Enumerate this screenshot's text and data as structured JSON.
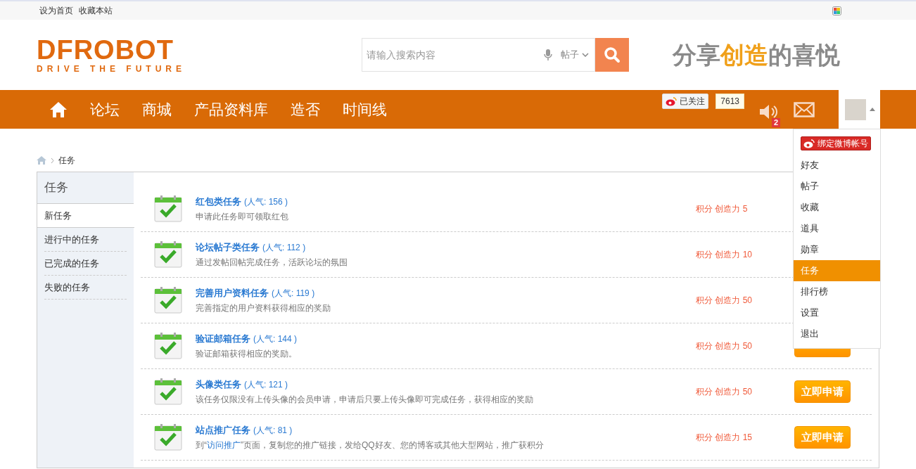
{
  "top_links": [
    "设为首页",
    "收藏本站"
  ],
  "logo": {
    "name": "DFROBOT",
    "tagline": "DRIVE THE FUTURE"
  },
  "search": {
    "placeholder": "请输入搜索内容",
    "scope": "帖子"
  },
  "slogan": {
    "before": "分享",
    "highlight": "创造",
    "after": "的喜悦"
  },
  "nav": [
    "论坛",
    "商城",
    "产品资料库",
    "造否",
    "时间线"
  ],
  "weibo": {
    "label": "已关注",
    "count": "7613"
  },
  "notice_badge": "2",
  "user_menu": {
    "bind_label": "绑定微博帐号",
    "items": [
      {
        "label": "好友",
        "selected": false
      },
      {
        "label": "帖子",
        "selected": false
      },
      {
        "label": "收藏",
        "selected": false
      },
      {
        "label": "道具",
        "selected": false
      },
      {
        "label": "勋章",
        "selected": false
      },
      {
        "label": "任务",
        "selected": true
      },
      {
        "label": "排行榜",
        "selected": false
      },
      {
        "label": "设置",
        "selected": false
      },
      {
        "label": "退出",
        "selected": false
      }
    ]
  },
  "breadcrumb": "任务",
  "sidebar": {
    "title": "任务",
    "items": [
      {
        "label": "新任务",
        "selected": true
      },
      {
        "label": "进行中的任务",
        "selected": false
      },
      {
        "label": "已完成的任务",
        "selected": false
      },
      {
        "label": "失败的任务",
        "selected": false
      }
    ]
  },
  "tasks": [
    {
      "title": "红包类任务",
      "popularity": "(人气: 156 )",
      "description": "申请此任务即可领取红包",
      "reward": "积分 创造力 5"
    },
    {
      "title": "论坛帖子类任务",
      "popularity": "(人气: 112 )",
      "description": "通过发帖回帖完成任务，活跃论坛的氛围",
      "reward": "积分 创造力 10"
    },
    {
      "title": "完善用户资料任务",
      "popularity": "(人气: 119 )",
      "description": "完善指定的用户资料获得相应的奖励",
      "reward": "积分 创造力 50"
    },
    {
      "title": "验证邮箱任务",
      "popularity": "(人气: 144 )",
      "description": "验证邮箱获得相应的奖励。",
      "reward": "积分 创造力 50"
    },
    {
      "title": "头像类任务",
      "popularity": "(人气: 121 )",
      "description": "该任务仅限没有上传头像的会员申请，申请后只要上传头像即可完成任务，获得相应的奖励",
      "reward": "积分 创造力 50",
      "action": "立即申请"
    },
    {
      "title": "站点推广任务",
      "popularity": "(人气: 81 )",
      "description": "到“",
      "link": "访问推广",
      "description_end": "”页面，复制您的推广链接，发给QQ好友、您的博客或其他大型网站，推广获积分",
      "reward": "积分 创造力 15",
      "action": "立即申请"
    }
  ]
}
